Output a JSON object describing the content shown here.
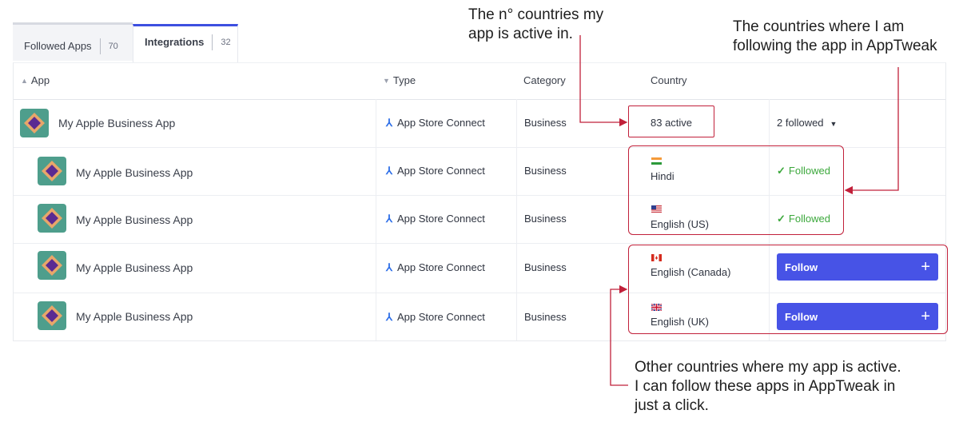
{
  "tabs": [
    {
      "label": "Followed Apps",
      "count": "70"
    },
    {
      "label": "Integrations",
      "count": "32"
    }
  ],
  "table": {
    "columns": {
      "app": "App",
      "type": "Type",
      "category": "Category",
      "country": "Country"
    },
    "parent_row": {
      "app_name": "My Apple Business App",
      "type": "App Store Connect",
      "category": "Business",
      "country_active": "83 active",
      "followed_dropdown": "2 followed"
    },
    "rows": [
      {
        "app_name": "My Apple Business App",
        "type": "App Store Connect",
        "category": "Business",
        "country": "Hindi",
        "status": "Followed"
      },
      {
        "app_name": "My Apple Business App",
        "type": "App Store Connect",
        "category": "Business",
        "country": "English (US)",
        "status": "Followed"
      },
      {
        "app_name": "My Apple Business App",
        "type": "App Store Connect",
        "category": "Business",
        "country": "English (Canada)",
        "action": "Follow"
      },
      {
        "app_name": "My Apple Business App",
        "type": "App Store Connect",
        "category": "Business",
        "country": "English (UK)",
        "action": "Follow"
      }
    ]
  },
  "annotations": {
    "active_count_line1": "The n° countries my",
    "active_count_line2": "app is active in.",
    "following_line1": "The countries where I am",
    "following_line2": "following the app in AppTweak",
    "other_line1": "Other countries where my app is active.",
    "other_line2": "I can follow these apps in AppTweak in",
    "other_line3": "just a click."
  },
  "colors": {
    "accent": "#4753e6",
    "tab_active": "#3d4fe0",
    "followed": "#3ca83c",
    "annotation": "#c1203a",
    "app_icon_bg": "#4e9e8c"
  },
  "icons": {
    "sort": "sort-arrows-icon",
    "type_sort": "caret-down-icon",
    "app_store_connect": "app-store-connect-icon",
    "check": "check-icon",
    "plus": "plus-icon",
    "dropdown": "caret-down-icon"
  }
}
